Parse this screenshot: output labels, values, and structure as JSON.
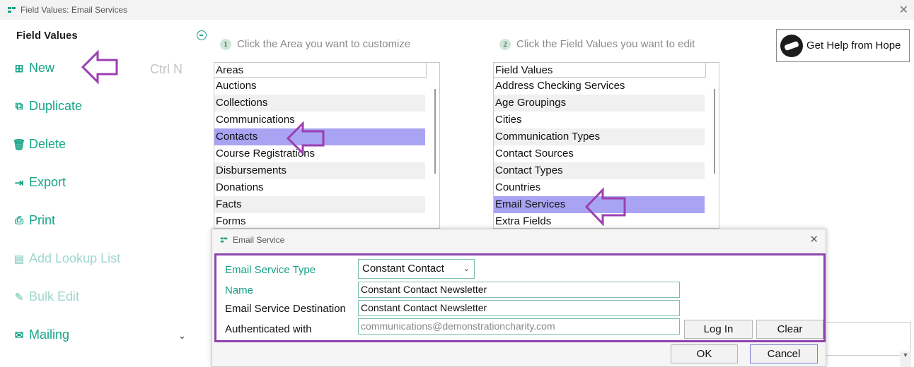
{
  "window": {
    "title": "Field Values: Email Services"
  },
  "sidebar": {
    "title": "Field Values",
    "items": [
      {
        "label": "New",
        "icon": "plus-square-icon",
        "shortcut": "Ctrl N",
        "disabled": false
      },
      {
        "label": "Duplicate",
        "icon": "duplicate-icon",
        "disabled": false
      },
      {
        "label": "Delete",
        "icon": "trash-icon",
        "disabled": false
      },
      {
        "label": "Export",
        "icon": "export-icon",
        "disabled": false
      },
      {
        "label": "Print",
        "icon": "printer-icon",
        "disabled": false
      },
      {
        "label": "Add Lookup List",
        "icon": "lookup-list-icon",
        "disabled": true
      },
      {
        "label": "Bulk Edit",
        "icon": "bulk-edit-icon",
        "disabled": true
      },
      {
        "label": "Mailing",
        "icon": "mailing-icon",
        "disabled": false
      }
    ]
  },
  "steps": {
    "one": {
      "num": "1",
      "text": "Click the Area you want to customize"
    },
    "two": {
      "num": "2",
      "text": "Click the Field Values you want to edit"
    }
  },
  "areas": {
    "header": "Areas",
    "items": [
      "Auctions",
      "Collections",
      "Communications",
      "Contacts",
      "Course Registrations",
      "Disbursements",
      "Donations",
      "Facts",
      "Forms"
    ],
    "selected": "Contacts"
  },
  "field_values": {
    "header": "Field Values",
    "items": [
      "Address Checking Services",
      "Age Groupings",
      "Cities",
      "Communication Types",
      "Contact Sources",
      "Contact Types",
      "Countries",
      "Email Services",
      "Extra Fields"
    ],
    "selected": "Email Services"
  },
  "help_button": {
    "label": "Get Help from Hope"
  },
  "dialog": {
    "title": "Email Service",
    "service_type_label": "Email Service Type",
    "service_type_value": "Constant Contact",
    "name_label": "Name",
    "name_value": "Constant Contact Newsletter",
    "destination_label": "Email Service Destination",
    "destination_value": "Constant Contact Newsletter",
    "auth_label": "Authenticated with",
    "auth_value": "communications@demonstrationcharity.com",
    "login_label": "Log In",
    "clear_label": "Clear",
    "ok_label": "OK",
    "cancel_label": "Cancel"
  },
  "colors": {
    "accent": "#16a085",
    "highlight": "#a9a3f4",
    "annotation": "#8e44ad"
  }
}
